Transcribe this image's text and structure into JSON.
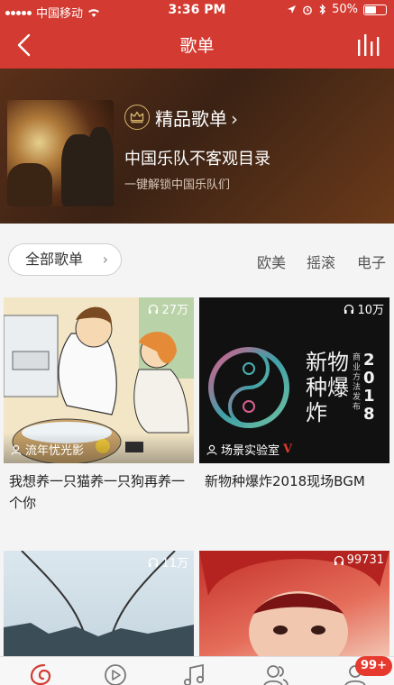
{
  "status_bar": {
    "carrier": "中国移动",
    "time": "3:36 PM",
    "battery": "50%"
  },
  "nav": {
    "title": "歌单"
  },
  "hero": {
    "tag": "精品歌单",
    "playlist_name": "中国乐队不客观目录",
    "subtitle": "一键解锁中国乐队们"
  },
  "filter": {
    "all_label": "全部歌单",
    "categories": [
      "欧美",
      "摇滚",
      "电子"
    ]
  },
  "playlists": [
    {
      "count": "27万",
      "creator": "流年忧光影",
      "title": "我想养一只猫养一只狗再养一个你"
    },
    {
      "count": "10万",
      "creator": "场景实验室",
      "title": "新物种爆炸2018现场BGM",
      "cover_text_main": "新物种爆炸",
      "cover_text_year": "2018",
      "cover_text_sub": "商业方法发布"
    },
    {
      "count": "11万",
      "creator": "",
      "title": ""
    },
    {
      "count": "99731",
      "creator": "",
      "title": ""
    }
  ],
  "tabbar": {
    "badge": "99+",
    "icons": [
      "netease-logo-icon",
      "video-icon",
      "music-note-icon",
      "friends-icon",
      "account-icon"
    ]
  },
  "colors": {
    "brand_red": "#d33a31",
    "badge_red": "#e63a2e"
  }
}
